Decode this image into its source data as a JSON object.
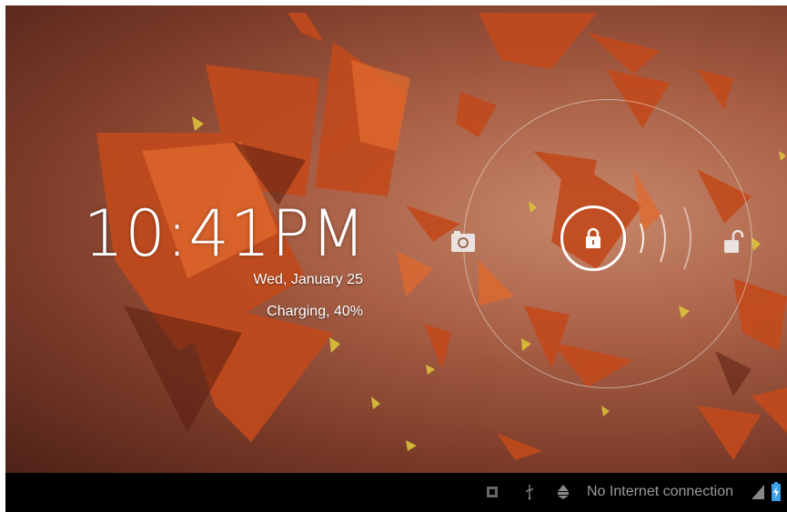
{
  "lockscreen": {
    "time": "10:41PM",
    "date": "Wed, January 25",
    "battery_status": "Charging, 40%",
    "targets": {
      "camera_icon": "camera-icon",
      "lock_icon": "lock-icon",
      "unlock_icon": "unlock-icon"
    }
  },
  "status_bar": {
    "network_text": "No Internet connection",
    "icons": [
      "notification-icon",
      "usb-icon",
      "debug-icon",
      "signal-icon",
      "battery-charging-icon"
    ]
  },
  "colors": {
    "accent_wallpaper": "#a85f45",
    "status_bar_bg": "#000000",
    "status_text": "#9a9a9a",
    "battery": "#3aa0e8"
  }
}
